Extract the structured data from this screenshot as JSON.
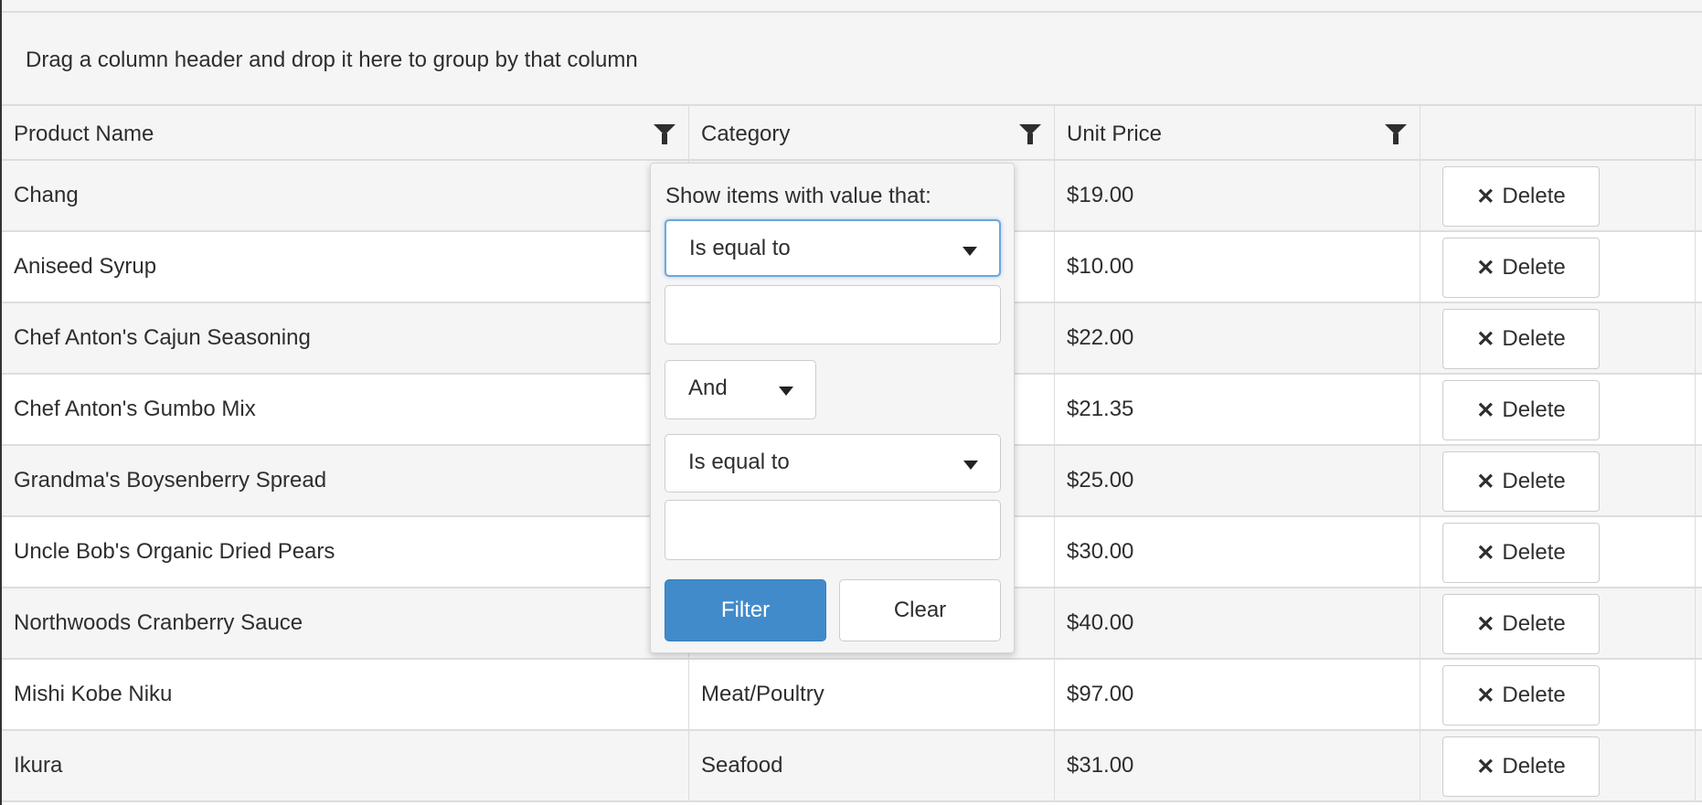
{
  "group_hint": "Drag a column header and drop it here to group by that column",
  "columns": [
    "Product Name",
    "Category",
    "Unit Price",
    ""
  ],
  "rows": [
    {
      "name": "Chang",
      "category": "",
      "price": "$19.00"
    },
    {
      "name": "Aniseed Syrup",
      "category": "",
      "price": "$10.00"
    },
    {
      "name": "Chef Anton's Cajun Seasoning",
      "category": "",
      "price": "$22.00"
    },
    {
      "name": "Chef Anton's Gumbo Mix",
      "category": "",
      "price": "$21.35"
    },
    {
      "name": "Grandma's Boysenberry Spread",
      "category": "",
      "price": "$25.00"
    },
    {
      "name": "Uncle Bob's Organic Dried Pears",
      "category": "",
      "price": "$30.00"
    },
    {
      "name": "Northwoods Cranberry Sauce",
      "category": "",
      "price": "$40.00"
    },
    {
      "name": "Mishi Kobe Niku",
      "category": "Meat/Poultry",
      "price": "$97.00"
    },
    {
      "name": "Ikura",
      "category": "Seafood",
      "price": "$31.00"
    }
  ],
  "delete_label": "Delete",
  "filter_menu": {
    "label": "Show items with value that:",
    "operator1": "Is equal to",
    "value1": "",
    "logic": "And",
    "operator2": "Is equal to",
    "value2": "",
    "filter_label": "Filter",
    "clear_label": "Clear",
    "accent": "#428bca"
  }
}
